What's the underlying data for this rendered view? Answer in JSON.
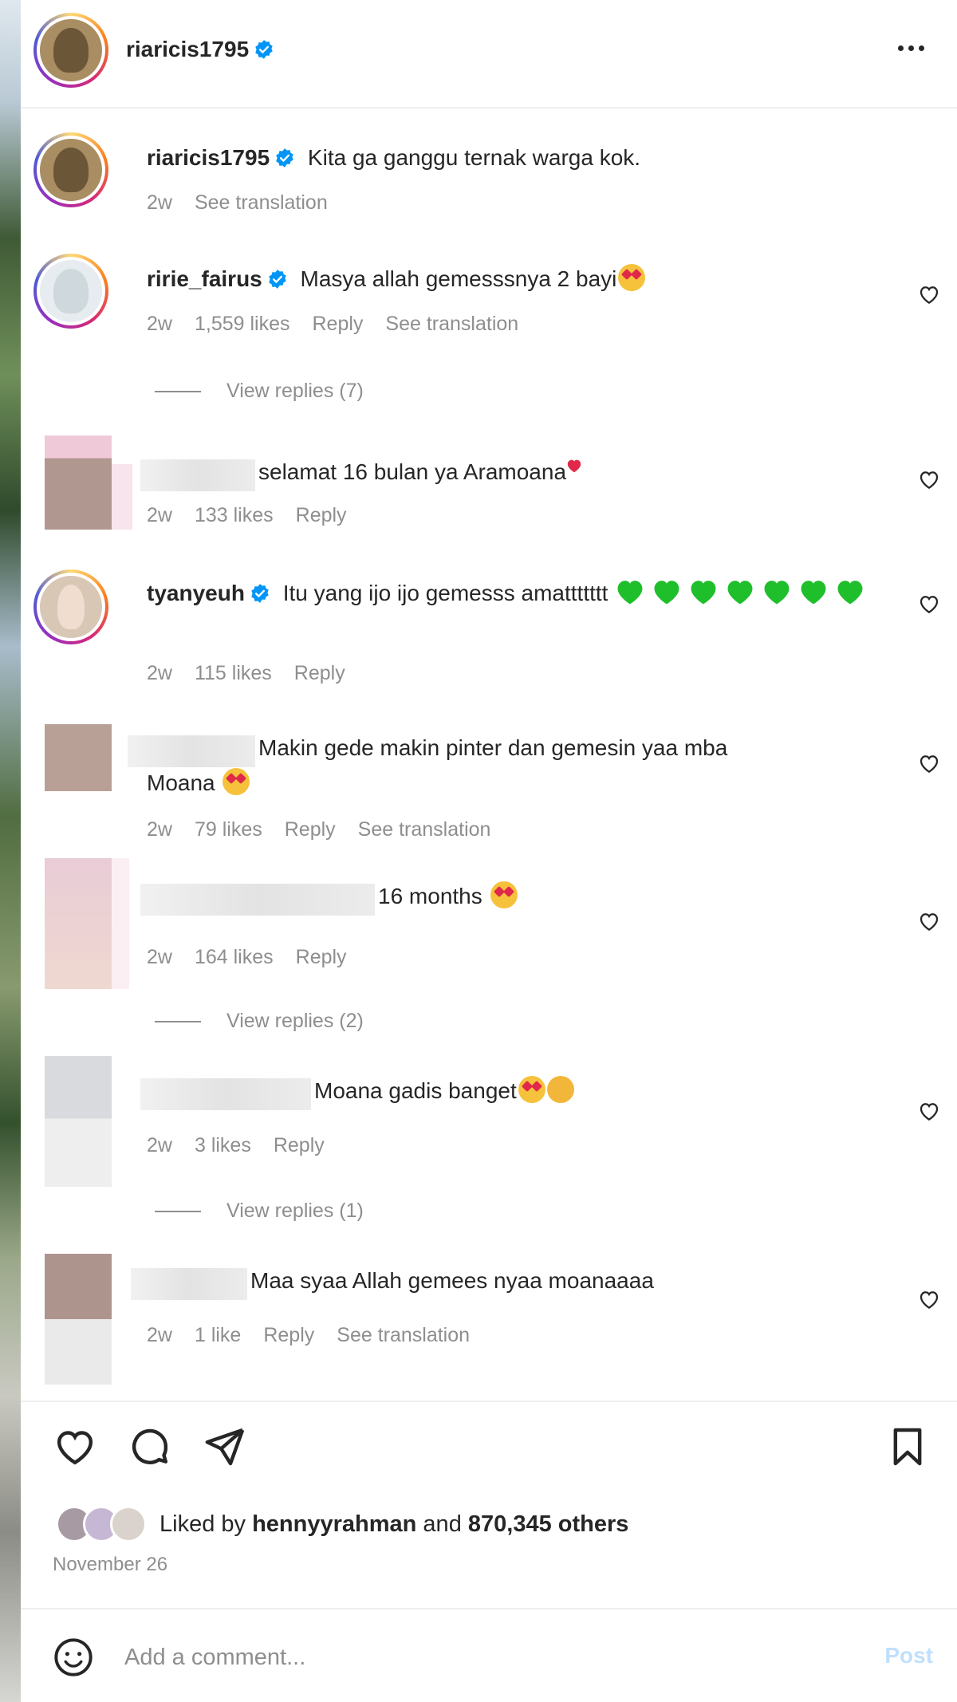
{
  "header": {
    "username": "riaricis1795"
  },
  "caption": {
    "username": "riaricis1795",
    "text": "Kita ga ganggu ternak warga kok.",
    "time": "2w",
    "see_translation": "See translation"
  },
  "comments": [
    {
      "username": "ririe_fairus",
      "text": "Masya allah gemesssnya 2 bayi",
      "time": "2w",
      "likes": "1,559 likes",
      "reply": "Reply",
      "see_translation": "See translation"
    },
    {
      "username": "",
      "text": "selamat 16 bulan ya Aramoana",
      "time": "2w",
      "likes": "133 likes",
      "reply": "Reply"
    },
    {
      "username": "tyanyeuh",
      "text": "Itu yang ijo ijo gemesss amattttttt",
      "time": "2w",
      "likes": "115 likes",
      "reply": "Reply"
    },
    {
      "username": "",
      "text": "Makin gede makin pinter dan gemesin yaa mba",
      "text2": "Moana",
      "time": "2w",
      "likes": "79 likes",
      "reply": "Reply",
      "see_translation": "See translation"
    },
    {
      "username": "",
      "text": "16 months",
      "time": "2w",
      "likes": "164 likes",
      "reply": "Reply"
    },
    {
      "username": "",
      "text": "Moana gadis banget",
      "time": "2w",
      "likes": "3 likes",
      "reply": "Reply"
    },
    {
      "username": "",
      "text": "Maa syaa Allah gemees nyaa moanaaaa",
      "time": "2w",
      "likes": "1 like",
      "reply": "Reply",
      "see_translation": "See translation"
    }
  ],
  "view_replies": [
    "View replies (7)",
    "View replies (2)",
    "View replies (1)"
  ],
  "likes": {
    "prefix": "Liked by ",
    "user": "hennyyrahman",
    "middle": " and ",
    "count": "870,345 others"
  },
  "date": "November 26",
  "add_comment": {
    "placeholder": "Add a comment...",
    "post": "Post"
  },
  "icons": [
    "more-icon",
    "verified-icon",
    "heart-icon",
    "comment-icon",
    "share-icon",
    "bookmark-icon",
    "emoji-icon"
  ]
}
